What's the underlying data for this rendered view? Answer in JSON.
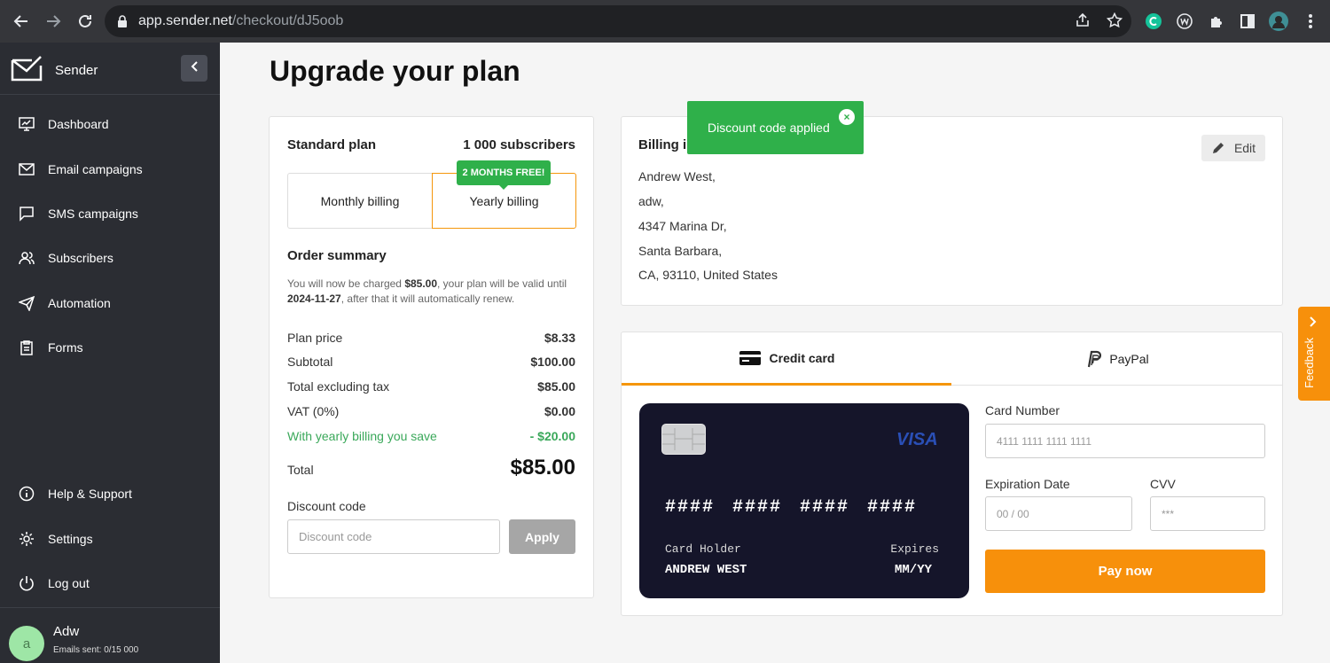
{
  "browser": {
    "url_host": "app.sender.net",
    "url_path": "/checkout/dJ5oob"
  },
  "sidebar": {
    "brand": "Sender",
    "nav": [
      {
        "label": "Dashboard",
        "icon": "dashboard-icon"
      },
      {
        "label": "Email campaigns",
        "icon": "envelope-icon"
      },
      {
        "label": "SMS campaigns",
        "icon": "chat-bubble-icon"
      },
      {
        "label": "Subscribers",
        "icon": "users-icon"
      },
      {
        "label": "Automation",
        "icon": "paper-plane-icon"
      },
      {
        "label": "Forms",
        "icon": "clipboard-icon"
      }
    ],
    "bottom": [
      {
        "label": "Help & Support",
        "icon": "info-icon"
      },
      {
        "label": "Settings",
        "icon": "gear-icon"
      },
      {
        "label": "Log out",
        "icon": "power-icon"
      }
    ],
    "user": {
      "avatar_letter": "a",
      "name": "Adw",
      "emails_sent": "Emails sent: 0/15 000"
    }
  },
  "page": {
    "title": "Upgrade your plan"
  },
  "plan": {
    "name": "Standard plan",
    "subscribers": "1 000 subscribers",
    "billing_options": {
      "monthly": "Monthly billing",
      "yearly": "Yearly billing",
      "selected": "yearly"
    },
    "badge": "2 MONTHS FREE!",
    "summary_title": "Order summary",
    "summary_text": {
      "p1": "You will now be charged ",
      "amount": "$85.00",
      "p2": ", your plan will be valid until ",
      "date": "2024-11-27",
      "p3": ", after that it will automatically renew."
    },
    "rows": [
      {
        "label": "Plan price",
        "value": "$8.33"
      },
      {
        "label": "Subtotal",
        "value": "$100.00"
      },
      {
        "label": "Total excluding tax",
        "value": "$85.00"
      },
      {
        "label": "VAT (0%)",
        "value": "$0.00"
      },
      {
        "label": "With yearly billing you save",
        "value": "- $20.00"
      }
    ],
    "total_label": "Total",
    "total_value": "$85.00",
    "discount": {
      "label": "Discount code",
      "placeholder": "Discount code",
      "value": "",
      "apply": "Apply"
    }
  },
  "billing": {
    "title": "Billing information",
    "edit": "Edit",
    "lines": [
      "Andrew West,",
      "adw,",
      "4347 Marina Dr,",
      "Santa Barbara,",
      "CA, 93110, United States"
    ]
  },
  "toast": {
    "message": "Discount code applied",
    "close": "×"
  },
  "payment": {
    "tabs": {
      "credit_card": "Credit card",
      "paypal": "PayPal",
      "selected": "credit_card"
    },
    "card": {
      "brand": "VISA",
      "number": "#### #### #### ####",
      "holder_label": "Card Holder",
      "holder_value": "ANDREW WEST",
      "expires_label": "Expires",
      "expires_value": "MM/YY"
    },
    "fields": {
      "card_number_label": "Card Number",
      "card_number_placeholder": "4111 1111 1111 1111",
      "expiration_label": "Expiration Date",
      "expiration_placeholder": "00 / 00",
      "cvv_label": "CVV",
      "cvv_placeholder": "***"
    },
    "pay_button": "Pay now"
  },
  "feedback": {
    "label": "Feedback"
  },
  "colors": {
    "accent_orange": "#f7900b",
    "success_green": "#2fb04a",
    "sidebar_bg": "#2b2d33"
  }
}
